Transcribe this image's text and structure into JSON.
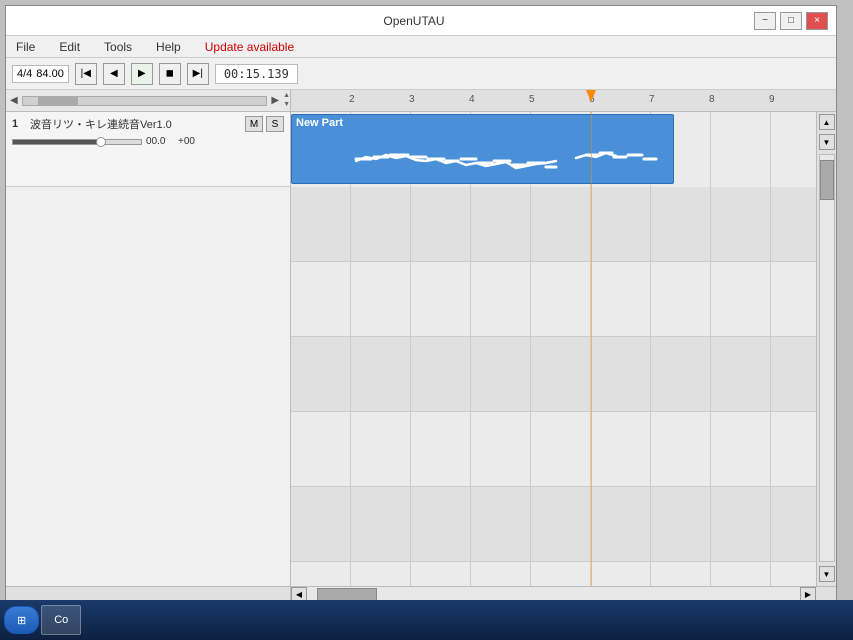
{
  "window": {
    "title": "OpenUTAU",
    "minimize_label": "−",
    "maximize_label": "□",
    "close_label": "×"
  },
  "menu": {
    "file": "File",
    "edit": "Edit",
    "tools": "Tools",
    "help": "Help",
    "update": "Update available"
  },
  "toolbar": {
    "time_sig": "4/4",
    "bpm": "84.00",
    "rewind_label": "|◀",
    "prev_label": "◀",
    "play_label": "▶",
    "stop_label": "◼",
    "next_label": "▶|",
    "time_display": "00:15.139"
  },
  "track": {
    "number": "1",
    "name": "波音リツ・キレ連続音Ver1.0",
    "mute_label": "M",
    "solo_label": "S",
    "volume": "00.0",
    "pan": "+00"
  },
  "sequencer": {
    "part_label": "New Part",
    "beat_markers": [
      "2",
      "3",
      "4",
      "5",
      "6",
      "7",
      "8",
      "9"
    ],
    "playhead_position": "1"
  },
  "scrollbar": {
    "left_arrow": "◀",
    "right_arrow": "▶",
    "up_arrow": "▲",
    "down_arrow": "▼"
  },
  "status": {
    "text": ""
  },
  "taskbar": {
    "start_label": "Start",
    "app_label": "Co"
  }
}
